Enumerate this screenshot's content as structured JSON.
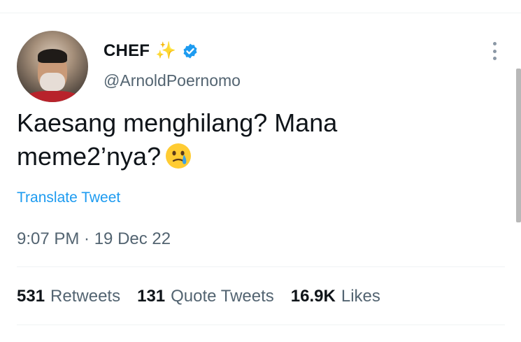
{
  "author": {
    "display_name": "CHEF",
    "name_emoji": "✨",
    "verified_icon": "verified-badge-icon",
    "handle": "@ArnoldPoernomo"
  },
  "tweet": {
    "text": "Kaesang menghilang? Mana meme2’nya?",
    "emoji_icon": "face-holding-back-tears-icon",
    "translate_label": "Translate Tweet",
    "timestamp": "9:07 PM · 19 Dec 22"
  },
  "stats": [
    {
      "count": "531",
      "label": "Retweets"
    },
    {
      "count": "131",
      "label": "Quote Tweets"
    },
    {
      "count": "16.9K",
      "label": "Likes"
    }
  ],
  "colors": {
    "accent": "#1d9bf0",
    "text": "#0f1419",
    "secondary": "#536471"
  }
}
